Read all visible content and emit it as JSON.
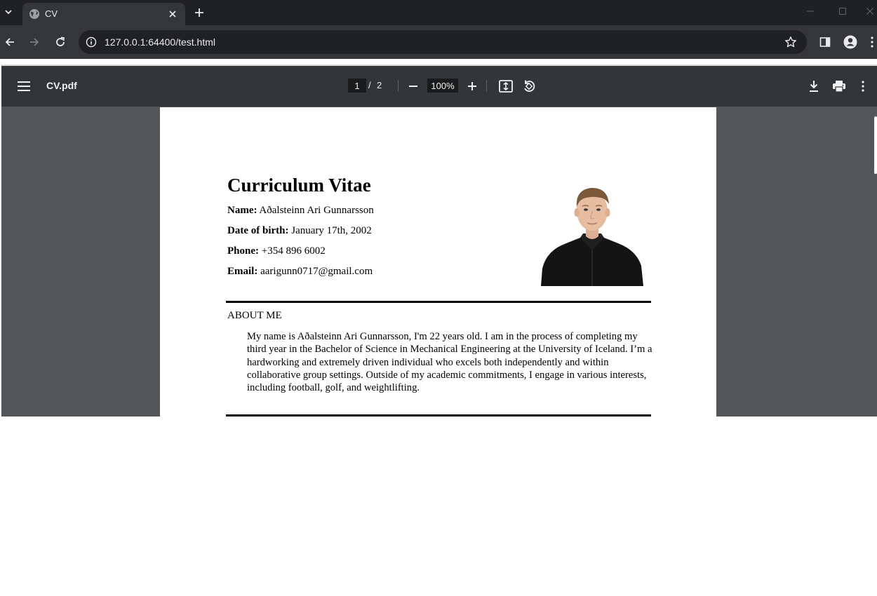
{
  "browser": {
    "tab": {
      "title": "CV"
    },
    "address": {
      "url": "127.0.0.1:64400/test.html"
    }
  },
  "pdf_viewer": {
    "file_name": "CV.pdf",
    "current_page": "1",
    "page_separator": "/",
    "total_pages": "2",
    "zoom": "100%"
  },
  "cv": {
    "title": "Curriculum Vitae",
    "fields": [
      {
        "label": "Name:",
        "value": "Aðalsteinn Ari Gunnarsson"
      },
      {
        "label": "Date of birth:",
        "value": "January 17th, 2002"
      },
      {
        "label": "Phone:",
        "value": "+354 896 6002"
      },
      {
        "label": "Email:",
        "value": "aarigunn0717@gmail.com"
      }
    ],
    "about_heading": "ABOUT ME",
    "about_text": "My name is Aðalsteinn Ari Gunnarsson, I'm 22 years old. I am in the process of completing my third year in the Bachelor of Science in Mechanical Engineering at the University of Iceland. I’m a hardworking and extremely driven individual who excels both independently and within collaborative group settings. Outside of my academic commitments, I engage in various interests, including football, golf, and weightlifting."
  },
  "colors": {
    "tabbar_bg": "#202124",
    "toolbar_bg": "#35363a",
    "pdf_toolbar_bg": "#323639",
    "viewer_bg": "#525659"
  }
}
